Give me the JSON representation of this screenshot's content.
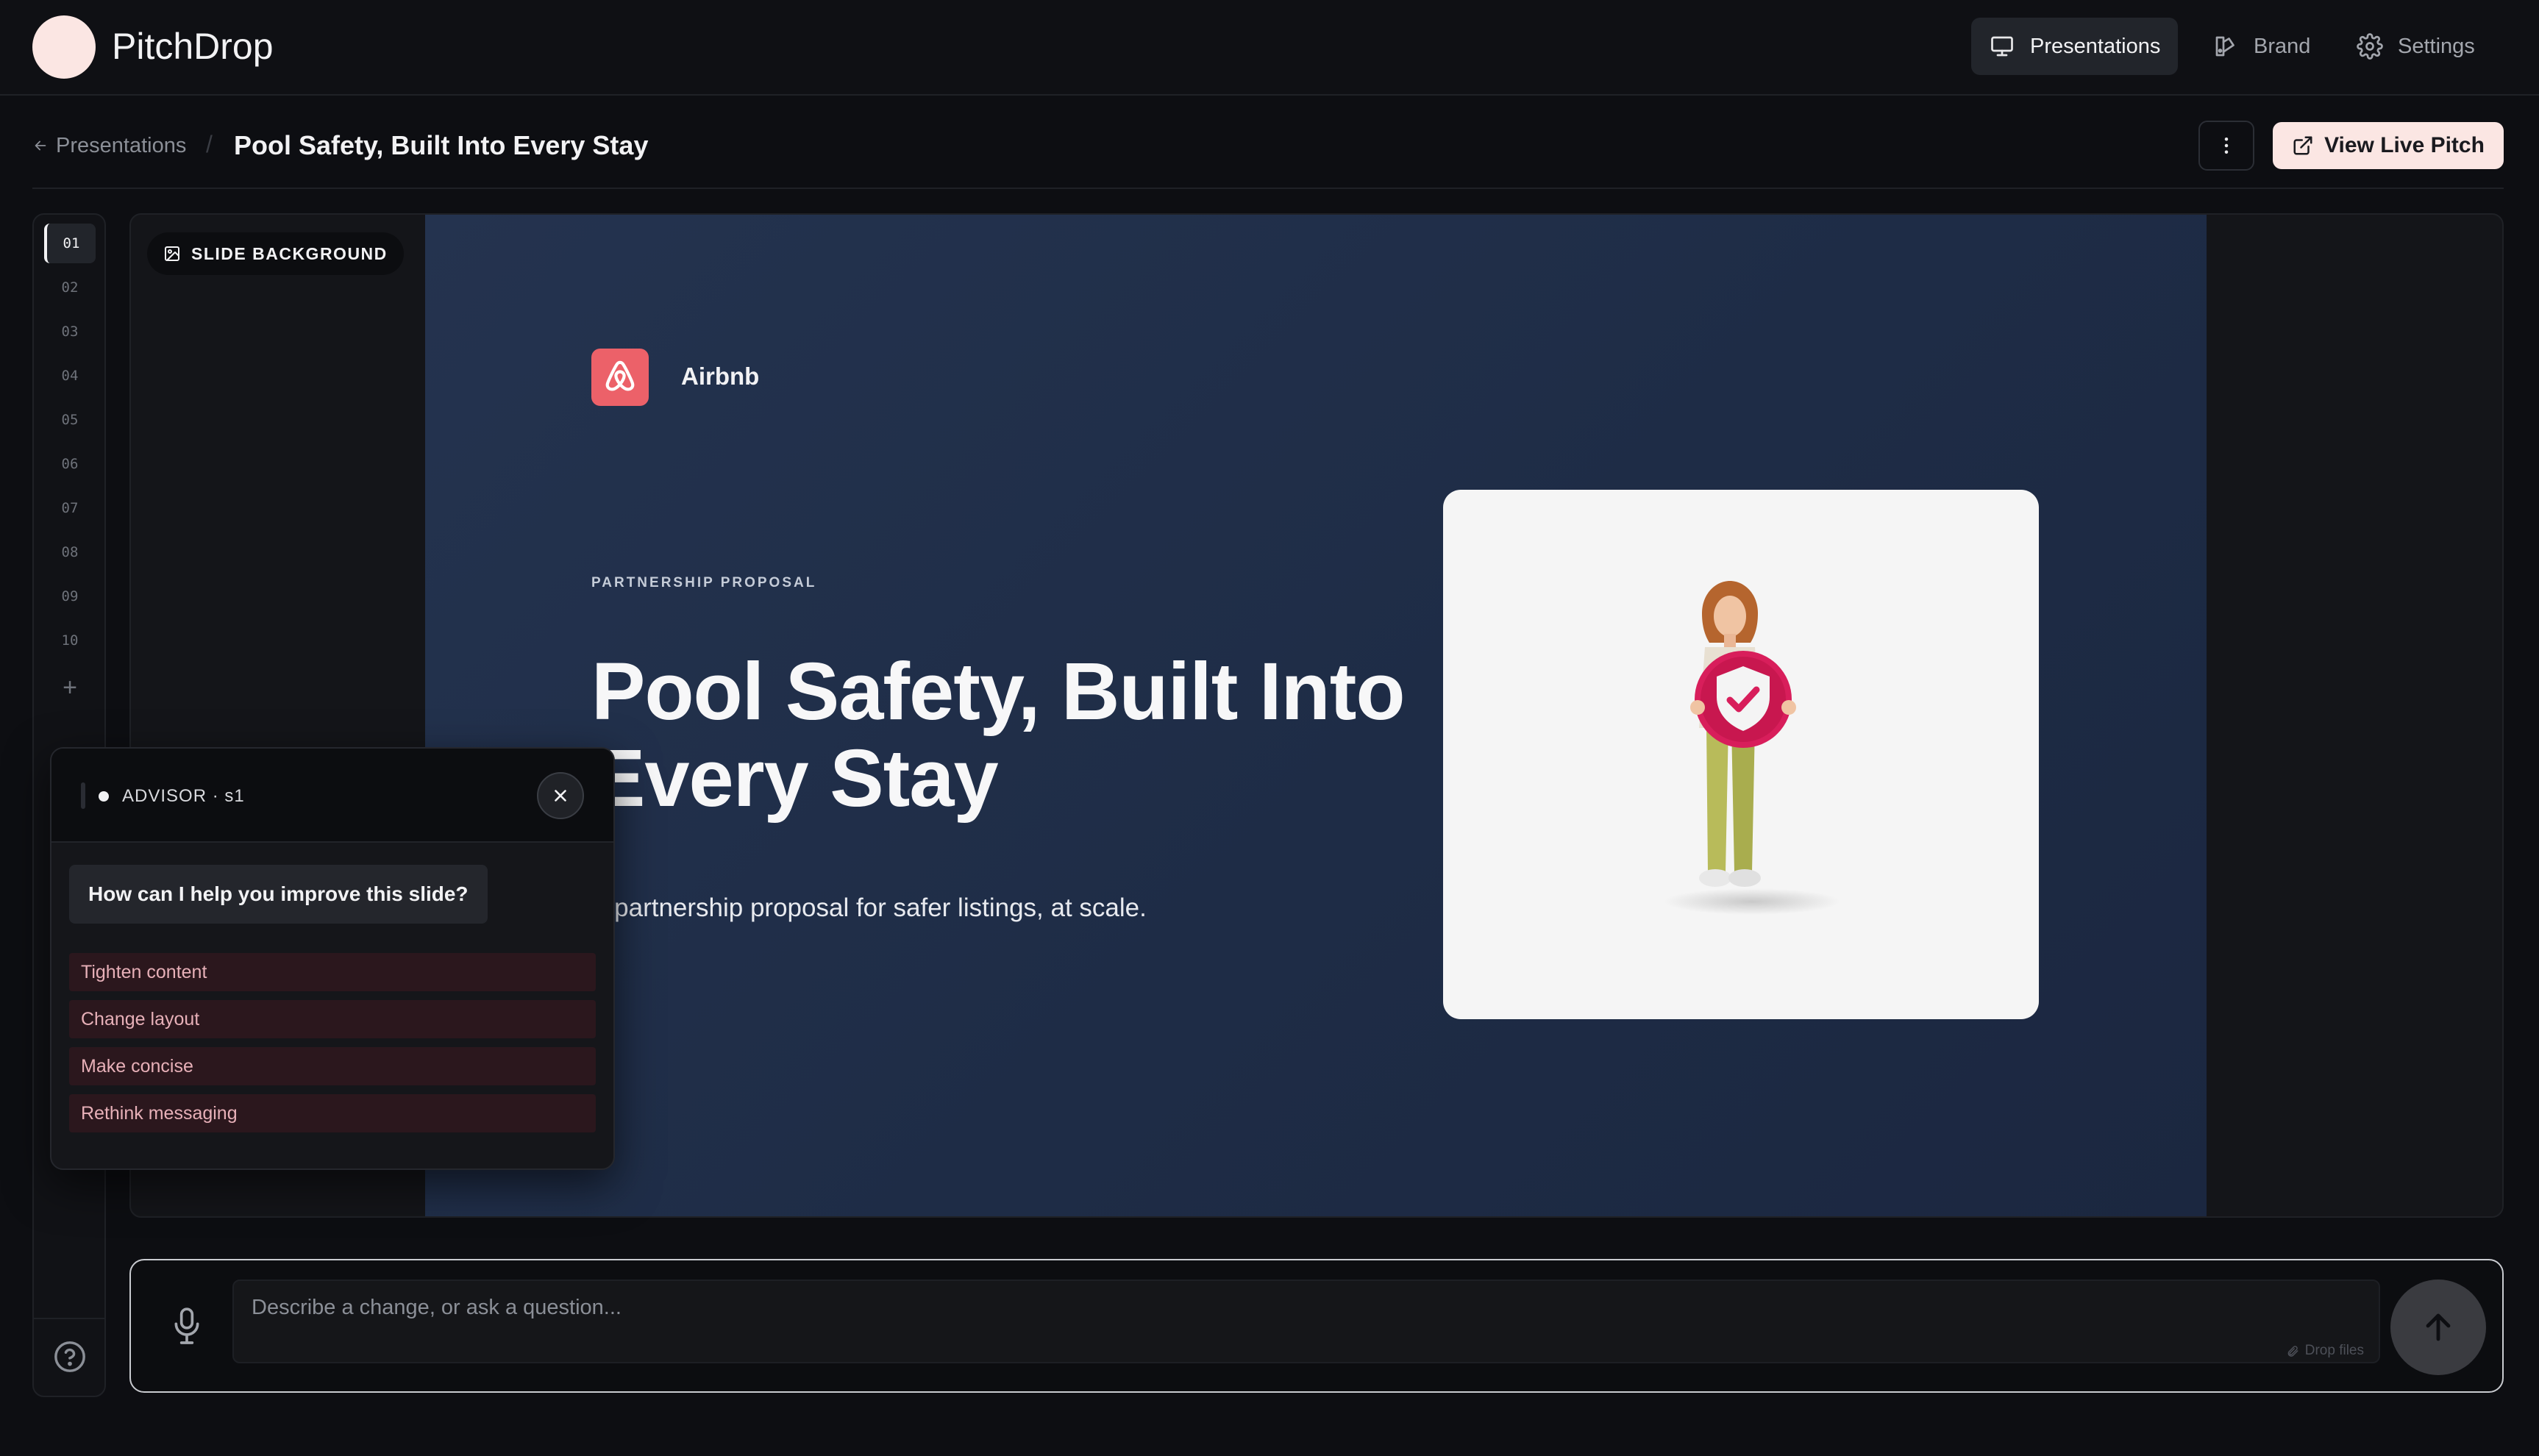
{
  "app": {
    "name": "PitchDrop"
  },
  "nav": {
    "presentations": "Presentations",
    "brand": "Brand",
    "settings": "Settings"
  },
  "header": {
    "back_label": "Presentations",
    "separator": "/",
    "title": "Pool Safety, Built Into Every Stay",
    "view_live": "View Live Pitch"
  },
  "rail": {
    "slides": [
      "01",
      "02",
      "03",
      "04",
      "05",
      "06",
      "07",
      "08",
      "09",
      "10"
    ],
    "active_index": 0,
    "add_symbol": "+"
  },
  "canvas": {
    "background_chip": "SLIDE BACKGROUND"
  },
  "slide": {
    "company": "Airbnb",
    "eyebrow": "PARTNERSHIP PROPOSAL",
    "title": "Pool Safety, Built Into Every Stay",
    "subtitle": "A partnership proposal for safer listings, at scale.",
    "hero_image": "woman-holding-shield-illustration"
  },
  "advisor": {
    "label": "ADVISOR · s1",
    "question": "How can I help you improve this slide?",
    "suggestions": [
      "Tighten content",
      "Change layout",
      "Make concise",
      "Rethink messaging"
    ]
  },
  "composer": {
    "placeholder": "Describe a change, or ask a question...",
    "drop_hint": "Drop files"
  },
  "colors": {
    "brand_pink": "#fbe6e3",
    "slide_bg": "#24334f",
    "airbnb_red": "#ec6169",
    "chip_bg": "#2b171d",
    "chip_text": "#e7b0b8"
  },
  "icons": [
    "presentation-icon",
    "brand-icon",
    "gear-icon",
    "arrow-left-icon",
    "more-vertical-icon",
    "external-link-icon",
    "image-icon",
    "airbnb-logo-icon",
    "close-icon",
    "microphone-icon",
    "arrow-up-icon",
    "help-icon",
    "paperclip-icon"
  ]
}
